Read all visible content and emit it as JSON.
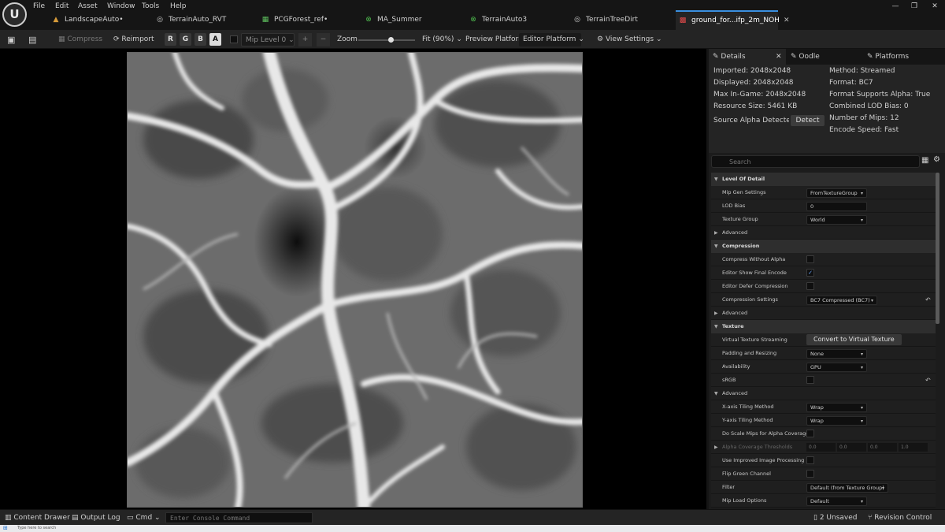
{
  "menu": [
    "File",
    "Edit",
    "Asset",
    "Window",
    "Tools",
    "Help"
  ],
  "tabs": [
    {
      "label": "LandscapeAuto•",
      "icon": "landscape-icon"
    },
    {
      "label": "TerrainAuto_RVT",
      "icon": "level-icon"
    },
    {
      "label": "PCGForest_ref•",
      "icon": "pcg-icon"
    },
    {
      "label": "MA_Summer",
      "icon": "material-icon"
    },
    {
      "label": "TerrainAuto3",
      "icon": "material-icon"
    },
    {
      "label": "TerrainTreeDirt",
      "icon": "level-icon"
    },
    {
      "label": "ground_for...ifp_2m_NOH",
      "icon": "texture-icon"
    }
  ],
  "toolbar": {
    "compress": "Compress",
    "reimport": "Reimport",
    "channels": [
      "R",
      "G",
      "B",
      "A"
    ],
    "mip_level": "Mip Level 0",
    "zoom": "Zoom",
    "fit": "Fit (90%)",
    "preview_platform_label": "Preview Platform:",
    "preview_platform_value": "Editor Platform",
    "view_settings": "View Settings"
  },
  "details_tabs": [
    "Details",
    "Oodle",
    "Platforms"
  ],
  "info_left": [
    "Imported: 2048x2048",
    "Displayed: 2048x2048",
    "Max In-Game: 2048x2048",
    "Resource Size: 5461 KB",
    "Source Alpha Detected: U"
  ],
  "detect_label": "Detect",
  "info_right": [
    "Method: Streamed",
    "Format: BC7",
    "Format Supports Alpha: True",
    "Combined LOD Bias: 0",
    "Number of Mips: 12",
    "Encode Speed: Fast"
  ],
  "search_placeholder": "Search",
  "level_of_detail": {
    "title": "Level Of Detail",
    "mip_gen_label": "Mip Gen Settings",
    "mip_gen_value": "FromTextureGroup",
    "lod_bias_label": "LOD Bias",
    "lod_bias_value": "0",
    "texture_group_label": "Texture Group",
    "texture_group_value": "World",
    "advanced": "Advanced"
  },
  "compression": {
    "title": "Compression",
    "without_alpha": "Compress Without Alpha",
    "show_final": "Editor Show Final Encode",
    "defer": "Editor Defer Compression",
    "settings_label": "Compression Settings",
    "settings_value": "BC7 Compressed (BC7)",
    "advanced": "Advanced"
  },
  "texture": {
    "title": "Texture",
    "vts_label": "Virtual Texture Streaming",
    "vts_button": "Convert to Virtual Texture",
    "padding_label": "Padding and Resizing",
    "padding_value": "None",
    "availability_label": "Availability",
    "availability_value": "GPU",
    "srgb_label": "sRGB",
    "advanced": "Advanced",
    "x_tiling_label": "X-axis Tiling Method",
    "x_tiling_value": "Wrap",
    "y_tiling_label": "Y-axis Tiling Method",
    "y_tiling_value": "Wrap",
    "scale_mips_label": "Do Scale Mips for Alpha Coverage",
    "alpha_thresholds_label": "Alpha Coverage Thresholds",
    "alpha_thresholds": [
      "0.0",
      "0.0",
      "0.0",
      "1.0"
    ],
    "improved_label": "Use Improved Image Processing",
    "flip_green_label": "Flip Green Channel",
    "filter_label": "Filter",
    "filter_value": "Default (from Texture Group)",
    "mip_load_label": "Mip Load Options",
    "mip_load_value": "Default"
  },
  "status": {
    "content_drawer": "Content Drawer",
    "output_log": "Output Log",
    "cmd": "Cmd",
    "console_placeholder": "Enter Console Command",
    "unsaved": "2 Unsaved",
    "revision": "Revision Control"
  },
  "taskbar": {
    "search": "Type here to search"
  }
}
